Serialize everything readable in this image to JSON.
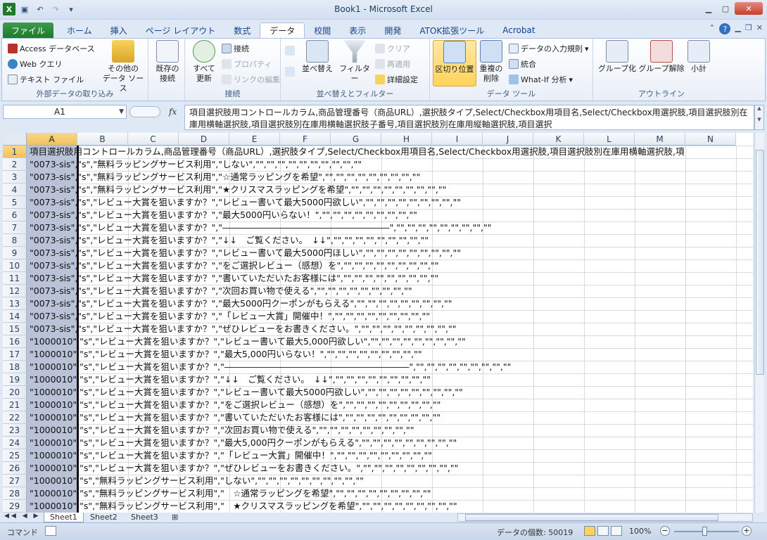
{
  "window": {
    "title": "Book1 - Microsoft Excel",
    "app_icon": "excel-icon"
  },
  "tabs": [
    {
      "label": "ファイル"
    },
    {
      "label": "ホーム"
    },
    {
      "label": "挿入"
    },
    {
      "label": "ページ レイアウト"
    },
    {
      "label": "数式"
    },
    {
      "label": "データ"
    },
    {
      "label": "校閲"
    },
    {
      "label": "表示"
    },
    {
      "label": "開発"
    },
    {
      "label": "ATOK拡張ツール"
    },
    {
      "label": "Acrobat"
    }
  ],
  "active_tab": "データ",
  "ribbon": {
    "external": {
      "label": "外部データの取り込み",
      "access": "Access データベース",
      "web": "Web クエリ",
      "text": "テキスト ファイル",
      "other_line1": "その他の",
      "other_line2": "データ ソース"
    },
    "existing_line1": "既存の",
    "existing_line2": "接続",
    "connections": {
      "label": "接続",
      "refresh_line1": "すべて",
      "refresh_line2": "更新",
      "connect": "接続",
      "properties": "プロパティ",
      "edit_links": "リンクの編集"
    },
    "sort": {
      "label": "並べ替えとフィルター",
      "sort": "並べ替え",
      "filter": "フィルター",
      "clear": "クリア",
      "reapply": "再適用",
      "advanced": "詳細設定"
    },
    "tools": {
      "label": "データ ツール",
      "split": "区切り位置",
      "dup_line1": "重複の",
      "dup_line2": "削除",
      "validation": "データの入力規則",
      "consolidate": "統合",
      "whatif": "What-If 分析"
    },
    "outline": {
      "label": "アウトライン",
      "group": "グループ化",
      "ungroup": "グループ解除",
      "subtotal": "小計"
    }
  },
  "namebox": "A1",
  "formula": "項目選択肢用コントロールカラム,商品管理番号（商品URL）,選択肢タイプ,Select/Checkbox用項目名,Select/Checkbox用選択肢,項目選択肢別在庫用横軸選択肢,項目選択肢別在庫用横軸選択肢子番号,項目選択肢別在庫用縦軸選択肢,項目選択",
  "columns": [
    "A",
    "B",
    "C",
    "D",
    "E",
    "F",
    "G",
    "H",
    "I",
    "J",
    "K",
    "L",
    "M",
    "N"
  ],
  "rows": [
    {
      "n": "1",
      "text": "項目選択肢用コントロールカラム,商品管理番号（商品URL）,選択肢タイプ,Select/Checkbox用項目名,Select/Checkbox用選択肢,項目選択肢別在庫用横軸選択肢,項"
    },
    {
      "n": "2",
      "text": "\"0073-sis\",\"s\",\"無料ラッピングサービス利用\",\"しない\",\"\",\"\",\"\",\"\",\"\",\"\",\"\",\"\",\"\",\"\""
    },
    {
      "n": "3",
      "text": "\"0073-sis\",\"s\",\"無料ラッピングサービス利用\",\"☆通常ラッピングを希望\",\"\",\"\",\"\",\"\",\"\",\"\",\"\",\"\",\"\""
    },
    {
      "n": "4",
      "text": "\"0073-sis\",\"s\",\"無料ラッピングサービス利用\",\"★クリスマスラッピングを希望\",\"\",\"\",\"\",\"\",\"\",\"\",\"\",\"\",\"\""
    },
    {
      "n": "5",
      "text": "\"0073-sis\",\"s\",\"レビュー大賞を狙いますか？\",\"レビュー書いて最大5000円欲しい\",\"\",\"\",\"\",\"\",\"\",\"\",\"\",\"\",\"\""
    },
    {
      "n": "6",
      "text": "\"0073-sis\",\"s\",\"レビュー大賞を狙いますか？\",\"最大5000円いらない！\",\"\",\"\",\"\",\"\",\"\",\"\",\"\",\"\",\"\""
    },
    {
      "n": "7",
      "text": "\"0073-sis\",\"s\",\"レビュー大賞を狙いますか？\",\"―――――――――――――――――――\",\"\",\"\",\"\",\"\",\"\",\"\",\"\",\"\",\"\""
    },
    {
      "n": "8",
      "text": "\"0073-sis\",\"s\",\"レビュー大賞を狙いますか？\",\"↓↓　ご覧ください。　↓↓\",\"\",\"\",\"\",\"\",\"\",\"\",\"\",\"\",\"\""
    },
    {
      "n": "9",
      "text": "\"0073-sis\",\"s\",\"レビュー大賞を狙いますか？\",\"レビュー書いて最大5000円ほしい\",\"\",\"\",\"\",\"\",\"\",\"\",\"\",\"\",\"\""
    },
    {
      "n": "10",
      "text": "\"0073-sis\",\"s\",\"レビュー大賞を狙いますか？\",\"をご選択レビュー（感想）を\",\"\",\"\",\"\",\"\",\"\",\"\",\"\",\"\",\"\""
    },
    {
      "n": "11",
      "text": "\"0073-sis\",\"s\",\"レビュー大賞を狙いますか？\",\"書いていただいたお客様には\",\"\",\"\",\"\",\"\",\"\",\"\",\"\",\"\",\"\""
    },
    {
      "n": "12",
      "text": "\"0073-sis\",\"s\",\"レビュー大賞を狙いますか？\",\"次回お買い物で使える\",\"\",\"\",\"\",\"\",\"\",\"\",\"\",\"\",\"\""
    },
    {
      "n": "13",
      "text": "\"0073-sis\",\"s\",\"レビュー大賞を狙いますか？\",\"最大5000円クーポンがもらえる\",\"\",\"\",\"\",\"\",\"\",\"\",\"\",\"\",\"\""
    },
    {
      "n": "14",
      "text": "\"0073-sis\",\"s\",\"レビュー大賞を狙いますか？\",\"「レビュー大賞」開催中！\",\"\",\"\",\"\",\"\",\"\",\"\",\"\",\"\",\"\""
    },
    {
      "n": "15",
      "text": "\"0073-sis\",\"s\",\"レビュー大賞を狙いますか？\",\"ぜひレビューをお書きください。\",\"\",\"\",\"\",\"\",\"\",\"\",\"\",\"\",\"\""
    },
    {
      "n": "16",
      "text": "\"1000010\",\"s\",\"レビュー大賞を狙いますか？\",\"レビュー書いて最大5,000円欲しい\",\"\",\"\",\"\",\"\",\"\",\"\",\"\",\"\",\"\""
    },
    {
      "n": "17",
      "text": "\"1000010\",\"s\",\"レビュー大賞を狙いますか？\",\"最大5,000円いらない！\",\"\",\"\",\"\",\"\",\"\",\"\",\"\",\"\",\"\""
    },
    {
      "n": "18",
      "text": "\"1000010\",\"s\",\"レビュー大賞を狙いますか？\",\"―――――――――――――――――――――\",\"\",\"\",\"\",\"\",\"\",\"\",\"\",\"\",\"\""
    },
    {
      "n": "19",
      "text": "\"1000010\",\"s\",\"レビュー大賞を狙いますか？\",\"↓↓　ご覧ください。　↓↓\",\"\",\"\",\"\",\"\",\"\",\"\",\"\",\"\",\"\""
    },
    {
      "n": "20",
      "text": "\"1000010\",\"s\",\"レビュー大賞を狙いますか？\",\"レビュー書いて最大5000円欲しい\",\"\",\"\",\"\",\"\",\"\",\"\",\"\",\"\",\"\""
    },
    {
      "n": "21",
      "text": "\"1000010\",\"s\",\"レビュー大賞を狙いますか？\",\"をご選択レビュー（感想）を\",\"\",\"\",\"\",\"\",\"\",\"\",\"\",\"\",\"\""
    },
    {
      "n": "22",
      "text": "\"1000010\",\"s\",\"レビュー大賞を狙いますか？\",\"書いていただいたお客様には\",\"\",\"\",\"\",\"\",\"\",\"\",\"\",\"\",\"\""
    },
    {
      "n": "23",
      "text": "\"1000010\",\"s\",\"レビュー大賞を狙いますか？\",\"次回お買い物で使える\",\"\",\"\",\"\",\"\",\"\",\"\",\"\",\"\",\"\""
    },
    {
      "n": "24",
      "text": "\"1000010\",\"s\",\"レビュー大賞を狙いますか？\",\"最大5,000円クーポンがもらえる\",\"\",\"\",\"\",\"\",\"\",\"\",\"\",\"\",\"\""
    },
    {
      "n": "25",
      "text": "\"1000010\",\"s\",\"レビュー大賞を狙いますか？\",\"「レビュー大賞」開催中！\",\"\",\"\",\"\",\"\",\"\",\"\",\"\",\"\",\"\""
    },
    {
      "n": "26",
      "text": "\"1000010\",\"s\",\"レビュー大賞を狙いますか？\",\"ぜひレビューをお書きください。\",\"\",\"\",\"\",\"\",\"\",\"\",\"\",\"\",\"\""
    },
    {
      "n": "27",
      "text": "\"1000010\",\"s\",\"無料ラッピングサービス利用\",\"しない\",\"\",\"\",\"\",\"\",\"\",\"\",\"\",\"\",\"\",\"\""
    },
    {
      "n": "28",
      "text": "\"1000010\",\"s\",\"無料ラッピングサービス利用\",\"　☆通常ラッピングを希望\",\"\",\"\",\"\",\"\",\"\",\"\",\"\",\"\",\"\""
    },
    {
      "n": "29",
      "text": "\"1000010\",\"s\",\"無料ラッピングサービス利用\",\"　★クリスマスラッピングを希望\",\"\",\"\",\"\",\"\",\"\",\"\",\"\",\"\",\"\""
    }
  ],
  "sheets": [
    "Sheet1",
    "Sheet2",
    "Sheet3"
  ],
  "status": {
    "mode": "コマンド",
    "count": "データの個数: 50019",
    "zoom": "100%"
  },
  "colors": {
    "file_tab": "#1f7a2c",
    "selected_column": "#b9c2d6",
    "header_highlight": "#f1c15f"
  }
}
